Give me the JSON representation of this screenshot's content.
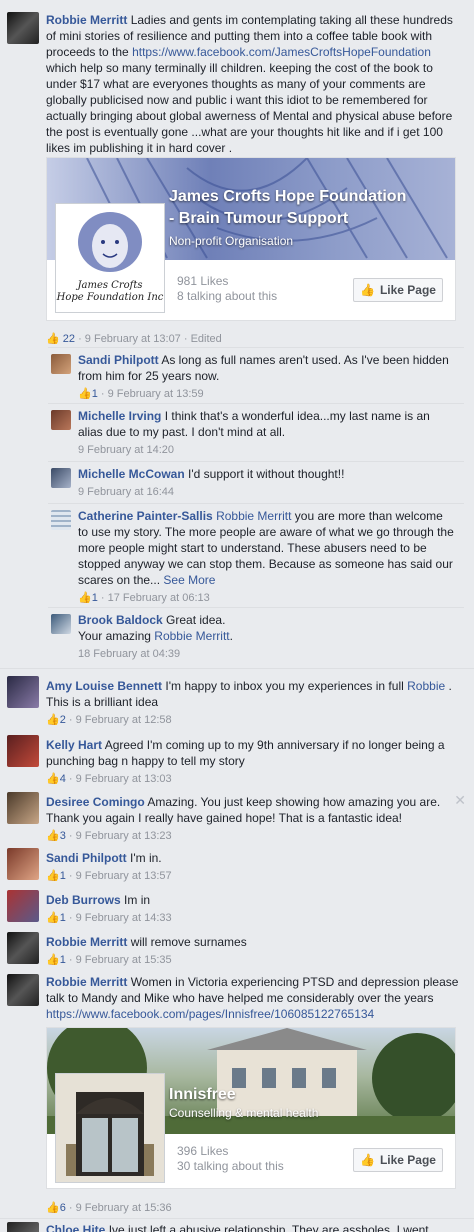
{
  "main_comment": {
    "author": "Robbie Merritt",
    "text_part1": "Ladies and gents im contemplating taking all these hundreds of mini stories of resilience and putting them into a coffee table book with proceeds to the",
    "link": "https://www.facebook.com/JamesCroftsHopeFoundation",
    "text_part2": "which help so many terminally ill children. keeping the cost of the book to under $17 what are everyones thoughts as many of your comments are globally publicised now and public i want this idiot to be remembered for actually bringing about global awerness of Mental and physical abuse before the post is eventually gone ...what are your thoughts hit like and if i get 100 likes im publishing it in hard cover .",
    "likes": "22",
    "time": "9 February at 13:07",
    "edited": "Edited"
  },
  "card1": {
    "title_line1": "James Crofts Hope Foundation",
    "title_line2": "- Brain Tumour Support",
    "category": "Non-profit Organisation",
    "logo_line1": "James Crofts",
    "logo_line2": "Hope Foundation Inc",
    "likes": "981 Likes",
    "talking": "8 talking about this",
    "like_button": "Like Page"
  },
  "replies": [
    {
      "author": "Sandi Philpott",
      "text": "As long as full names aren't used. As I've been hidden from him for 25 years now.",
      "likes": "1",
      "time": "9 February at 13:59"
    },
    {
      "author": "Michelle Irving",
      "text": "I think that's a wonderful idea...my last name is an alias due to my past. I don't mind at all.",
      "time": "9 February at 14:20"
    },
    {
      "author": "Michelle McCowan",
      "text": "I'd support it without thought!!",
      "time": "9 February at 16:44"
    },
    {
      "author": "Catherine Painter-Sallis",
      "mention": "Robbie Merritt",
      "text": "you are more than welcome to use my story. The more people are aware of what we go through the more people might start to understand. These abusers need to be stopped anyway we can stop them. Because as someone has said our scares on the...",
      "see_more": "See More",
      "likes": "1",
      "time": "17 February at 06:13"
    },
    {
      "author": "Brook Baldock",
      "text": "Great idea.",
      "text2": "Your amazing",
      "mention": "Robbie Merritt",
      "time": "18 February at 04:39"
    }
  ],
  "comments": [
    {
      "author": "Amy Louise Bennett",
      "text": "I'm happy to inbox you my experiences in full",
      "mention": "Robbie",
      "text2": "This is a brilliant idea",
      "likes": "2",
      "time": "9 February at 12:58"
    },
    {
      "author": "Kelly Hart",
      "text": "Agreed I'm coming up to my 9th anniversary if no longer being a punching bag n happy to tell my story",
      "likes": "4",
      "time": "9 February at 13:03"
    },
    {
      "author": "Desiree Comingo",
      "text": "Amazing. You just keep showing how amazing you are. Thank you again I really have gained hope! That is a fantastic idea!",
      "likes": "3",
      "time": "9 February at 13:23"
    },
    {
      "author": "Sandi Philpott",
      "text": "I'm in.",
      "likes": "1",
      "time": "9 February at 13:57"
    },
    {
      "author": "Deb Burrows",
      "text": "Im in",
      "likes": "1",
      "time": "9 February at 14:33"
    },
    {
      "author": "Robbie Merritt",
      "text": "will remove surnames",
      "likes": "1",
      "time": "9 February at 15:35"
    },
    {
      "author": "Robbie Merritt",
      "text": "Women in Victoria experiencing PTSD and depression please talk to Mandy and Mike who have helped me considerably over the years",
      "link": "https://www.facebook.com/pages/Innisfree/106085122765134",
      "likes": "6",
      "time": "9 February at 15:36"
    },
    {
      "author": "Chloe Hite",
      "text": "Ive just left a abusive relationship. They are assholes. I went"
    }
  ],
  "card2": {
    "title": "Innisfree",
    "category": "Counselling & mental health",
    "likes": "396 Likes",
    "talking": "30 talking about this",
    "like_button": "Like Page"
  },
  "colors": {
    "link": "#365899",
    "meta": "#90949c",
    "background": "#e9ebee"
  },
  "icons": [
    "like-thumb-icon",
    "close-icon"
  ]
}
